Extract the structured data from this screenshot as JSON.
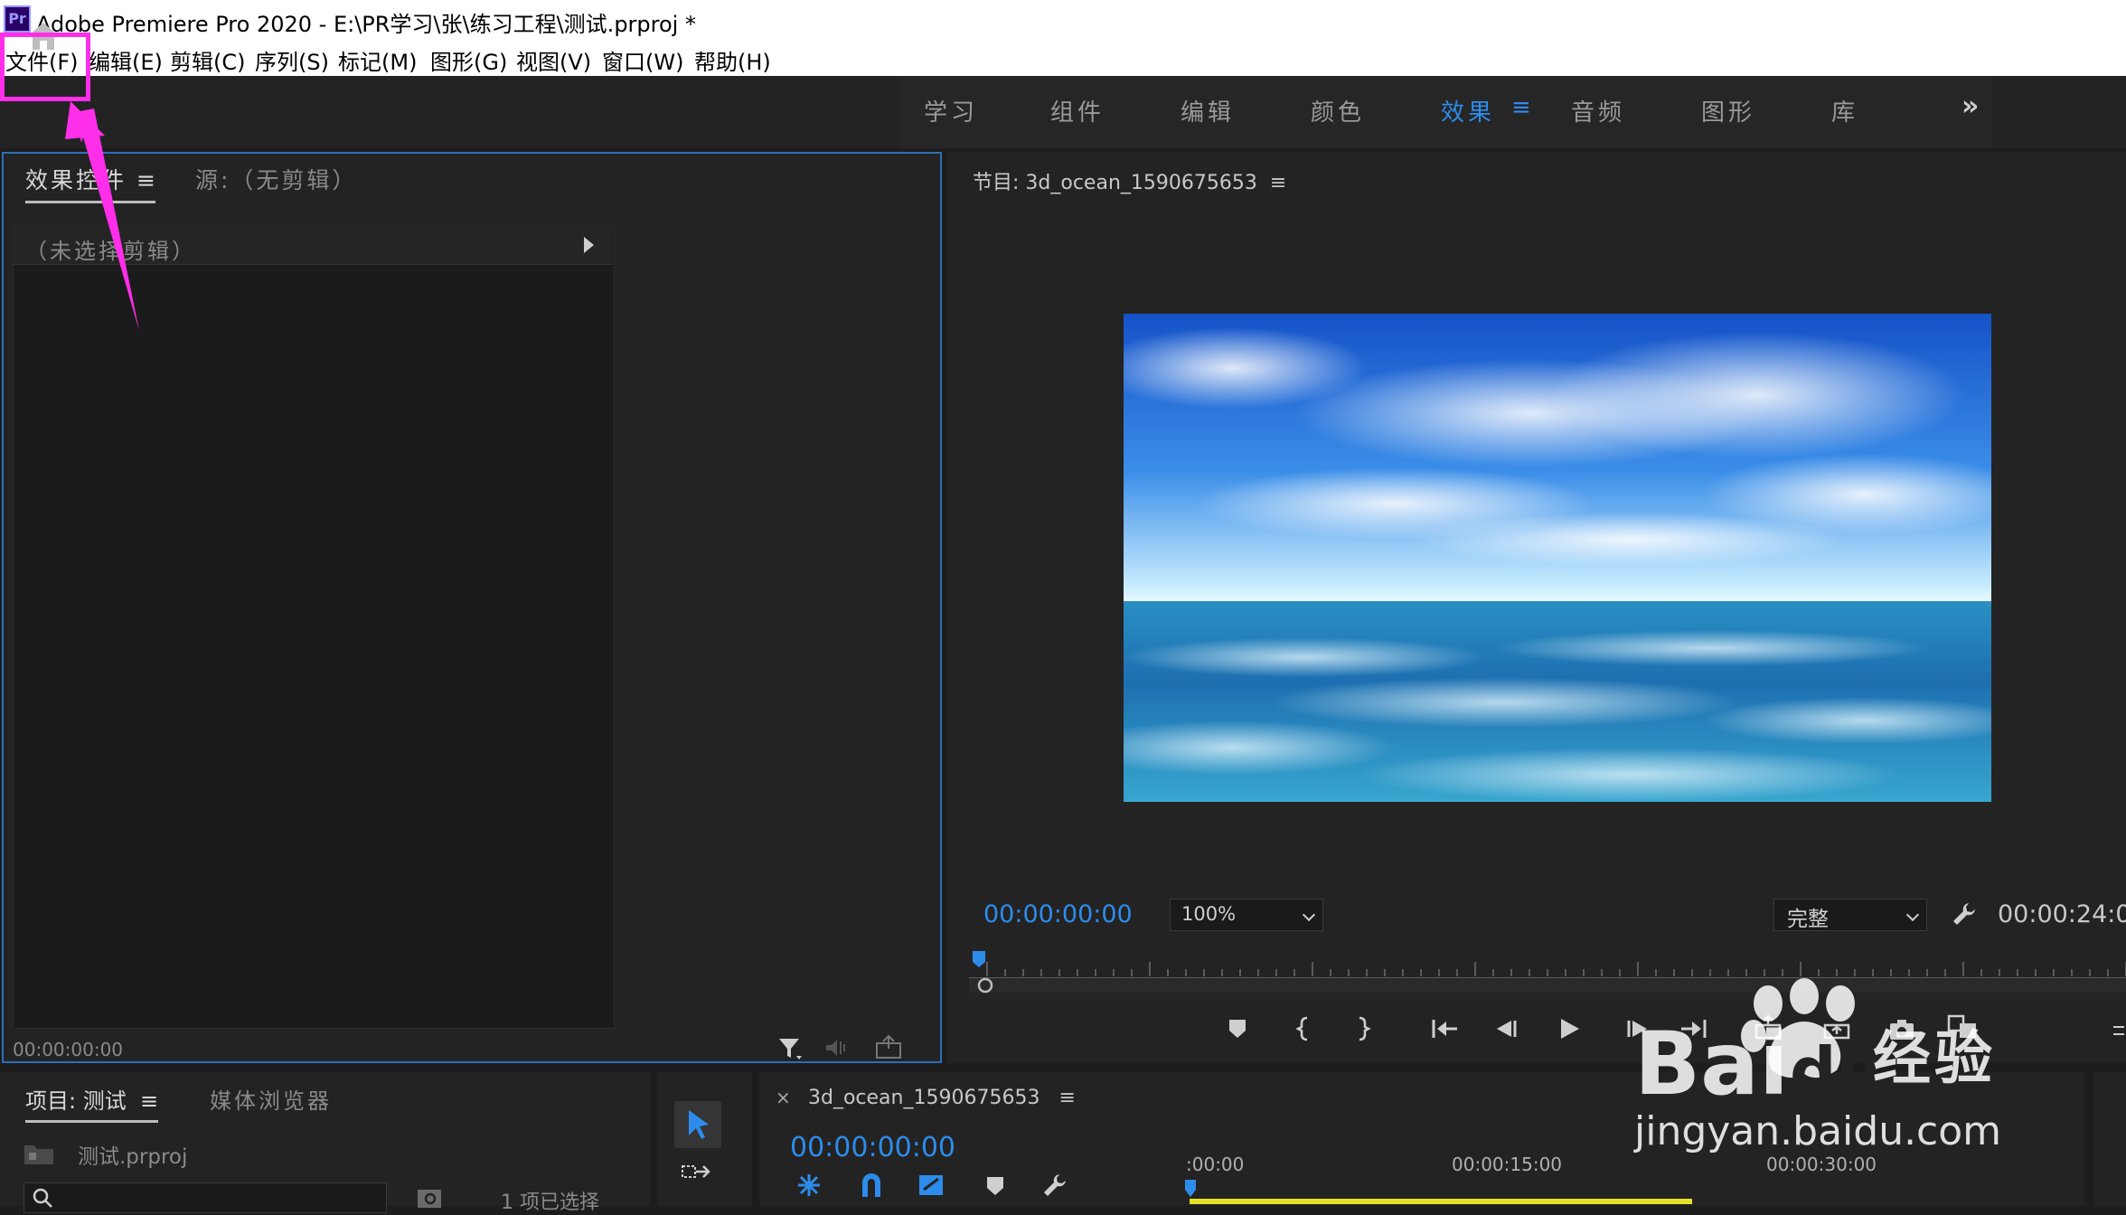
{
  "window": {
    "logo": "Pr",
    "title": "Adobe Premiere Pro 2020 - E:\\PR学习\\张\\练习工程\\测试.prproj *"
  },
  "menu": [
    {
      "label": "文件(F)"
    },
    {
      "label": "编辑(E)"
    },
    {
      "label": "剪辑(C)"
    },
    {
      "label": "序列(S)"
    },
    {
      "label": "标记(M)"
    },
    {
      "label": "图形(G)"
    },
    {
      "label": "视图(V)"
    },
    {
      "label": "窗口(W)"
    },
    {
      "label": "帮助(H)"
    }
  ],
  "workspaces": {
    "tabs": [
      "学习",
      "组件",
      "编辑",
      "颜色",
      "效果",
      "音频",
      "图形",
      "库"
    ],
    "active": "效果",
    "active_menu_glyph": "≡",
    "more": "»"
  },
  "effects_panel": {
    "tab_effect_controls": "效果控件",
    "tab_menu_glyph": "≡",
    "tab_source": "源:（无剪辑）",
    "no_clip": "（未选择剪辑）",
    "timecode": "00:00:00:00"
  },
  "program_monitor": {
    "title": "节目: 3d_ocean_1590675653",
    "menu_glyph": "≡",
    "timecode": "00:00:00:00",
    "zoom": "100%",
    "quality": "完整",
    "duration": "00:00:24:0"
  },
  "project_panel": {
    "tab_project": "项目: 测试",
    "menu_glyph": "≡",
    "tab_media_browser": "媒体浏览器",
    "file": "测试.prproj",
    "items_selected": "1 项已选择"
  },
  "timeline": {
    "close": "×",
    "title": "3d_ocean_1590675653",
    "menu_glyph": "≡",
    "timecode": "00:00:00:00",
    "ticks": [
      ":00:00",
      "00:00:15:00",
      "00:00:30:00"
    ]
  },
  "watermark": {
    "brand": "Bai",
    "brand2": "du",
    "jingyan": "经验",
    "url": "jingyan.baidu.com"
  },
  "colors": {
    "accent_blue": "#2d8ceb",
    "annotation_magenta": "#ff2ee8",
    "work_area_yellow": "#e6e02a"
  }
}
